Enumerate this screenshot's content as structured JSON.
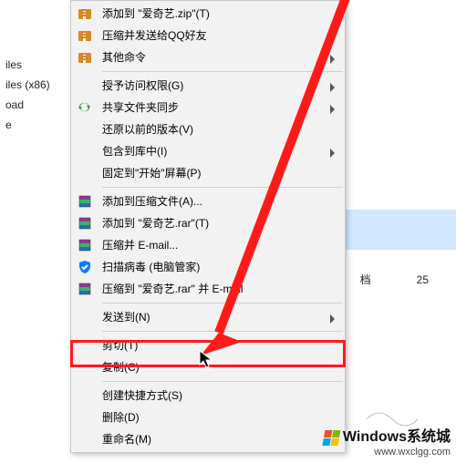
{
  "sidebar": {
    "items": [
      {
        "label": "iles"
      },
      {
        "label": "iles (x86)"
      },
      {
        "label": "oad"
      },
      {
        "label": "e"
      }
    ]
  },
  "background_rows": [
    {
      "col1": "",
      "col2": "",
      "selected": true
    },
    {
      "col1": "",
      "col2": "",
      "selected": true
    },
    {
      "col1": "",
      "col2": "",
      "selected": false
    },
    {
      "col1": "档",
      "col2": "25",
      "selected": false
    }
  ],
  "menu": {
    "groups": [
      [
        {
          "label": "添加到 \"爱奇艺.zip\"(T)",
          "icon": "zip-icon",
          "submenu": false
        },
        {
          "label": "压缩并发送给QQ好友",
          "icon": "zip-icon",
          "submenu": false
        },
        {
          "label": "其他命令",
          "icon": "zip-icon",
          "submenu": true
        }
      ],
      [
        {
          "label": "授予访问权限(G)",
          "icon": null,
          "submenu": true
        },
        {
          "label": "共享文件夹同步",
          "icon": "sync-icon",
          "submenu": true
        },
        {
          "label": "还原以前的版本(V)",
          "icon": null,
          "submenu": false
        },
        {
          "label": "包含到库中(I)",
          "icon": null,
          "submenu": true
        },
        {
          "label": "固定到\"开始\"屏幕(P)",
          "icon": null,
          "submenu": false
        }
      ],
      [
        {
          "label": "添加到压缩文件(A)...",
          "icon": "rar-icon",
          "submenu": false
        },
        {
          "label": "添加到 \"爱奇艺.rar\"(T)",
          "icon": "rar-icon",
          "submenu": false
        },
        {
          "label": "压缩并 E-mail...",
          "icon": "rar-icon",
          "submenu": false
        },
        {
          "label": "扫描病毒 (电脑管家)",
          "icon": "shield-icon",
          "submenu": false
        },
        {
          "label": "压缩到 \"爱奇艺.rar\" 并 E-mail",
          "icon": "rar-icon",
          "submenu": false
        }
      ],
      [
        {
          "label": "发送到(N)",
          "icon": null,
          "submenu": true
        }
      ],
      [
        {
          "label": "剪切(T)",
          "icon": null,
          "submenu": false
        },
        {
          "label": "复制(C)",
          "icon": null,
          "submenu": false
        }
      ],
      [
        {
          "label": "创建快捷方式(S)",
          "icon": null,
          "submenu": false
        },
        {
          "label": "删除(D)",
          "icon": null,
          "submenu": false
        },
        {
          "label": "重命名(M)",
          "icon": null,
          "submenu": false
        }
      ]
    ]
  },
  "watermark": {
    "title": "Windows系统城",
    "url": "www.wxclgg.com",
    "logo_colors": [
      "#f25022",
      "#7fba00",
      "#00a4ef",
      "#ffb900"
    ]
  },
  "icons": {
    "zip_color": "#d48a2a",
    "rar_stack": [
      "#8e3b8e",
      "#3bb273",
      "#2b6cb0"
    ],
    "sync_color": "#2f8f2f",
    "shield_bg": "#0a7cff",
    "shield_check": "#ffffff"
  }
}
